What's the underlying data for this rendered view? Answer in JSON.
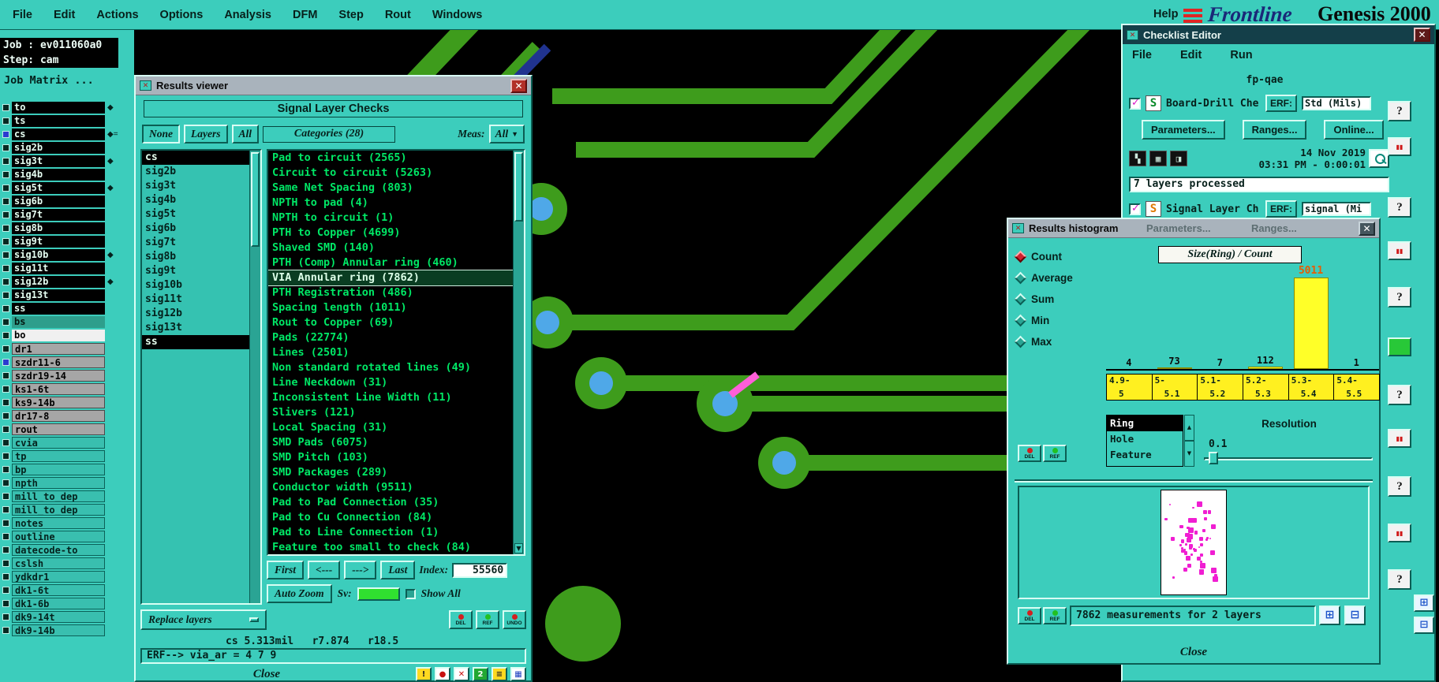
{
  "menu_bar": {
    "items": [
      "File",
      "Edit",
      "Actions",
      "Options",
      "Analysis",
      "DFM",
      "Step",
      "Rout",
      "Windows"
    ],
    "help_label": "Help",
    "brand": "Frontline",
    "product": "Genesis 2000"
  },
  "sidebar": {
    "job_label": "Job : ev011060a0",
    "step_label": "Step: cam",
    "matrix_label": "Job Matrix ...",
    "layers": [
      {
        "name": "to",
        "style": "black",
        "marker": "◆",
        "box": ""
      },
      {
        "name": "ts",
        "style": "black",
        "marker": "",
        "box": ""
      },
      {
        "name": "cs",
        "style": "black",
        "marker": "◆=",
        "box": "blue"
      },
      {
        "name": "sig2b",
        "style": "black",
        "marker": "",
        "box": ""
      },
      {
        "name": "sig3t",
        "style": "black",
        "marker": "◆",
        "box": ""
      },
      {
        "name": "sig4b",
        "style": "black",
        "marker": "",
        "box": ""
      },
      {
        "name": "sig5t",
        "style": "black",
        "marker": "◆",
        "box": ""
      },
      {
        "name": "sig6b",
        "style": "black",
        "marker": "",
        "box": ""
      },
      {
        "name": "sig7t",
        "style": "black",
        "marker": "",
        "box": ""
      },
      {
        "name": "sig8b",
        "style": "black",
        "marker": "",
        "box": ""
      },
      {
        "name": "sig9t",
        "style": "black",
        "marker": "",
        "box": ""
      },
      {
        "name": "sig10b",
        "style": "black",
        "marker": "◆",
        "box": ""
      },
      {
        "name": "sig11t",
        "style": "black",
        "marker": "",
        "box": ""
      },
      {
        "name": "sig12b",
        "style": "black",
        "marker": "◆",
        "box": ""
      },
      {
        "name": "sig13t",
        "style": "black",
        "marker": "",
        "box": ""
      },
      {
        "name": "ss",
        "style": "black",
        "marker": "",
        "box": ""
      },
      {
        "name": "bs",
        "style": "tealrow",
        "marker": "",
        "box": ""
      },
      {
        "name": "bo",
        "style": "white",
        "marker": "",
        "box": ""
      },
      {
        "name": "dr1",
        "style": "gray",
        "marker": "",
        "box": ""
      },
      {
        "name": "szdr11-6",
        "style": "gray",
        "marker": "",
        "box": "blue"
      },
      {
        "name": "szdr19-14",
        "style": "gray",
        "marker": "",
        "box": ""
      },
      {
        "name": "ks1-6t",
        "style": "gray",
        "marker": "",
        "box": ""
      },
      {
        "name": "ks9-14b",
        "style": "gray",
        "marker": "",
        "box": ""
      },
      {
        "name": "dr17-8",
        "style": "gray",
        "marker": "",
        "box": ""
      },
      {
        "name": "rout",
        "style": "gray",
        "marker": "",
        "box": ""
      },
      {
        "name": "cvia",
        "style": "btn",
        "marker": "",
        "box": ""
      },
      {
        "name": "tp",
        "style": "btn",
        "marker": "",
        "box": ""
      },
      {
        "name": "bp",
        "style": "btn",
        "marker": "",
        "box": ""
      },
      {
        "name": "npth",
        "style": "btn",
        "marker": "",
        "box": ""
      },
      {
        "name": "mill_to_dep",
        "style": "btn",
        "marker": "",
        "box": ""
      },
      {
        "name": "mill_to_dep",
        "style": "btn",
        "marker": "",
        "box": ""
      },
      {
        "name": "notes",
        "style": "btn",
        "marker": "",
        "box": ""
      },
      {
        "name": "outline",
        "style": "btn",
        "marker": "",
        "box": ""
      },
      {
        "name": "datecode-to",
        "style": "btn",
        "marker": "",
        "box": ""
      },
      {
        "name": "cslsh",
        "style": "btn",
        "marker": "",
        "box": ""
      },
      {
        "name": "ydkdr1",
        "style": "btn",
        "marker": "",
        "box": ""
      },
      {
        "name": "dk1-6t",
        "style": "btn",
        "marker": "",
        "box": ""
      },
      {
        "name": "dk1-6b",
        "style": "btn",
        "marker": "",
        "box": ""
      },
      {
        "name": "dk9-14t",
        "style": "btn",
        "marker": "",
        "box": ""
      },
      {
        "name": "dk9-14b",
        "style": "btn",
        "marker": "",
        "box": ""
      }
    ]
  },
  "results_viewer": {
    "title": "Results viewer",
    "header": "Signal Layer Checks",
    "filter_none": "None",
    "filter_layers": "Layers",
    "filter_all": "All",
    "categories_label": "Categories (28)",
    "meas_label": "Meas:",
    "meas_value": "All",
    "layer_list": [
      {
        "name": "cs",
        "state": "selected"
      },
      {
        "name": "sig2b",
        "state": ""
      },
      {
        "name": "sig3t",
        "state": ""
      },
      {
        "name": "sig4b",
        "state": ""
      },
      {
        "name": "sig5t",
        "state": ""
      },
      {
        "name": "sig6b",
        "state": ""
      },
      {
        "name": "sig7t",
        "state": ""
      },
      {
        "name": "sig8b",
        "state": ""
      },
      {
        "name": "sig9t",
        "state": ""
      },
      {
        "name": "sig10b",
        "state": ""
      },
      {
        "name": "sig11t",
        "state": ""
      },
      {
        "name": "sig12b",
        "state": ""
      },
      {
        "name": "sig13t",
        "state": ""
      },
      {
        "name": "ss",
        "state": "selected"
      }
    ],
    "categories": [
      {
        "text": "Pad to circuit (2565)",
        "state": ""
      },
      {
        "text": "Circuit to circuit (5263)",
        "state": ""
      },
      {
        "text": "Same Net Spacing (803)",
        "state": ""
      },
      {
        "text": "NPTH to pad (4)",
        "state": ""
      },
      {
        "text": "NPTH to circuit (1)",
        "state": ""
      },
      {
        "text": "PTH to Copper (4699)",
        "state": ""
      },
      {
        "text": "Shaved SMD (140)",
        "state": ""
      },
      {
        "text": "PTH (Comp) Annular ring (460)",
        "state": ""
      },
      {
        "text": "VIA Annular ring (7862)",
        "state": "selected"
      },
      {
        "text": "PTH Registration (486)",
        "state": ""
      },
      {
        "text": "Spacing length (1011)",
        "state": ""
      },
      {
        "text": "Rout to Copper (69)",
        "state": ""
      },
      {
        "text": "Pads (22774)",
        "state": ""
      },
      {
        "text": "Lines (2501)",
        "state": ""
      },
      {
        "text": "Non standard rotated lines (49)",
        "state": ""
      },
      {
        "text": "Line Neckdown (31)",
        "state": ""
      },
      {
        "text": "Inconsistent Line Width (11)",
        "state": ""
      },
      {
        "text": "Slivers (121)",
        "state": ""
      },
      {
        "text": "Local Spacing (31)",
        "state": ""
      },
      {
        "text": "SMD Pads (6075)",
        "state": ""
      },
      {
        "text": "SMD Pitch (103)",
        "state": ""
      },
      {
        "text": "SMD Packages (289)",
        "state": ""
      },
      {
        "text": "Conductor width (9511)",
        "state": ""
      },
      {
        "text": "Pad to Pad Connection (35)",
        "state": ""
      },
      {
        "text": "Pad to Cu Connection (84)",
        "state": ""
      },
      {
        "text": "Pad to Line Connection (1)",
        "state": ""
      },
      {
        "text": "Feature too small to check (84)",
        "state": ""
      }
    ],
    "nav": {
      "first": "First",
      "prev": "<---",
      "next": "--->",
      "last": "Last",
      "index_label": "Index:",
      "index_value": "55560"
    },
    "zoom": {
      "auto_zoom": "Auto Zoom",
      "sv_label": "Sv:",
      "show_all": "Show All"
    },
    "replace_layers": "Replace layers",
    "action_buttons": [
      {
        "label": "DEL",
        "dot": "dot-red"
      },
      {
        "label": "REF",
        "dot": "dot-green"
      },
      {
        "label": "UNDO",
        "dot": "dot-red"
      }
    ],
    "status_line": "cs 5.313mil   r7.874   r18.5",
    "erf_line": "ERF--> via_ar = 4 7 9",
    "close_label": "Close",
    "footer_icons": [
      {
        "glyph": "!",
        "style": "yellow",
        "name": "warning-icon"
      },
      {
        "glyph": "●",
        "style": "red",
        "name": "record-icon"
      },
      {
        "glyph": "✕",
        "style": "white",
        "name": "delete-icon"
      },
      {
        "glyph": "2",
        "style": "green",
        "name": "dual-view-icon"
      },
      {
        "glyph": "≡",
        "style": "yellow",
        "name": "list-icon"
      },
      {
        "glyph": "▦",
        "style": "chart",
        "name": "grid-icon"
      }
    ]
  },
  "checklist_editor": {
    "title": "Checklist Editor",
    "menus": [
      "File",
      "Edit",
      "Run"
    ],
    "name": "fp-qae",
    "rows": [
      {
        "label": "Board-Drill Che",
        "erf_label": "ERF:",
        "erf_value": "Std (Mils)",
        "icon": "green",
        "icon_glyph": "S"
      },
      {
        "label": "Signal Layer Ch",
        "erf_label": "ERF:",
        "erf_value": "signal (Mi",
        "icon": "orange",
        "icon_glyph": "S"
      }
    ],
    "buttons": {
      "parameters": "Parameters...",
      "ranges": "Ranges...",
      "online": "Online..."
    },
    "tool_icons": [
      "▚",
      "▦",
      "◨"
    ],
    "run_date": "14 Nov 2019",
    "run_time": "03:31 PM - 0:00:01",
    "status": "7 layers processed",
    "help_glyph": "?",
    "pause_glyph": "▮▮",
    "export_icons": [
      "⊞",
      "⊟"
    ]
  },
  "results_histogram": {
    "title": "Results histogram",
    "stats": [
      {
        "label": "Count",
        "state": "selected"
      },
      {
        "label": "Average",
        "state": ""
      },
      {
        "label": "Sum",
        "state": ""
      },
      {
        "label": "Min",
        "state": ""
      },
      {
        "label": "Max",
        "state": ""
      }
    ],
    "chart": {
      "type": "bar",
      "title": "Size(Ring) / Count",
      "bins": [
        "4.9-5",
        "5-5.1",
        "5.1-5.2",
        "5.2-5.3",
        "5.3-5.4",
        "5.4-5.5"
      ],
      "bin_labels": [
        {
          "top": "4.9-",
          "bottom": "5"
        },
        {
          "top": "5-",
          "bottom": "5.1"
        },
        {
          "top": "5.1-",
          "bottom": "5.2"
        },
        {
          "top": "5.2-",
          "bottom": "5.3"
        },
        {
          "top": "5.3-",
          "bottom": "5.4"
        },
        {
          "top": "5.4-",
          "bottom": "5.5"
        }
      ],
      "values": [
        4,
        73,
        7,
        112,
        5011,
        1
      ],
      "max_value": 5011,
      "bar_color": "#FFFF28",
      "max_label_color": "#E85C00"
    },
    "modes": [
      {
        "label": "Ring",
        "state": "selected"
      },
      {
        "label": "Hole",
        "state": ""
      },
      {
        "label": "Feature",
        "state": ""
      }
    ],
    "resolution_label": "Resolution",
    "resolution_value": "0.1",
    "del_label": "DEL",
    "ref_label": "REF",
    "measurements_text": "7862 measurements for 2 layers",
    "close_label": "Close"
  }
}
